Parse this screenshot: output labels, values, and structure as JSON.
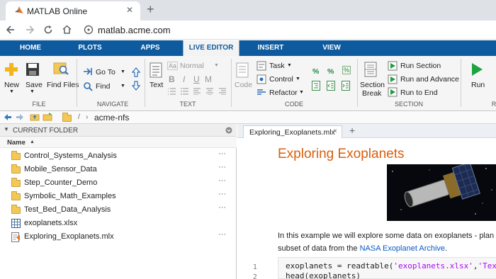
{
  "browser": {
    "tab_title": "MATLAB Online",
    "close_glyph": "✕",
    "new_tab_glyph": "+",
    "url": "matlab.acme.com"
  },
  "ribbon_tabs": [
    "HOME",
    "PLOTS",
    "APPS",
    "LIVE EDITOR",
    "INSERT",
    "VIEW"
  ],
  "active_tab": "LIVE EDITOR",
  "ribbon": {
    "file": {
      "group": "FILE",
      "new": "New",
      "save": "Save",
      "find_files": "Find Files"
    },
    "navigate": {
      "group": "NAVIGATE",
      "go_to": "Go To",
      "find": "Find"
    },
    "text": {
      "group": "TEXT",
      "text": "Text",
      "style": "Normal",
      "bold": "B",
      "italic": "I",
      "underline": "U",
      "mono": "M"
    },
    "code": {
      "group": "CODE",
      "code": "Code",
      "task": "Task",
      "control": "Control",
      "refactor": "Refactor"
    },
    "section": {
      "group": "SECTION",
      "section_break_1": "Section",
      "section_break_2": "Break",
      "run_section": "Run Section",
      "run_and_advance": "Run and Advance",
      "run_to_end": "Run to End"
    },
    "run": {
      "label": "Run",
      "group_partial": "R"
    }
  },
  "address": {
    "sep": "/",
    "folder": "acme-nfs"
  },
  "current_folder": {
    "header": "CURRENT FOLDER",
    "column": "Name",
    "items": [
      {
        "name": "Control_Systems_Analysis",
        "type": "folder"
      },
      {
        "name": "Mobile_Sensor_Data",
        "type": "folder"
      },
      {
        "name": "Step_Counter_Demo",
        "type": "folder"
      },
      {
        "name": "Symbolic_Math_Examples",
        "type": "folder"
      },
      {
        "name": "Test_Bed_Data_Analysis",
        "type": "folder"
      },
      {
        "name": "exoplanets.xlsx",
        "type": "spreadsheet"
      },
      {
        "name": "Exploring_Exoplanets.mlx",
        "type": "livescript"
      }
    ],
    "more_glyph": "···"
  },
  "editor": {
    "tab": "Exploring_Exoplanets.mlx",
    "tab_close": "×",
    "plus": "+",
    "title": "Exploring Exoplanets",
    "para_line1": "In this example we will explore some data on exoplanets - plan",
    "para_line2_pre": "subset of data from the ",
    "para_link": "NASA Exoplanet Archive",
    "para_line2_post": ".",
    "code": {
      "line1_num": "1",
      "line2_num": "2",
      "line1_pre": "exoplanets = readtable(",
      "line1_str1": "'exoplanets.xlsx'",
      "line1_mid": ",",
      "line1_str2": "'TextTyp",
      "line2": "head(exoplanets)"
    }
  },
  "colors": {
    "ribbon_blue": "#0e5a9e",
    "title_orange": "#d95f0e",
    "link_blue": "#0b5bbf"
  }
}
